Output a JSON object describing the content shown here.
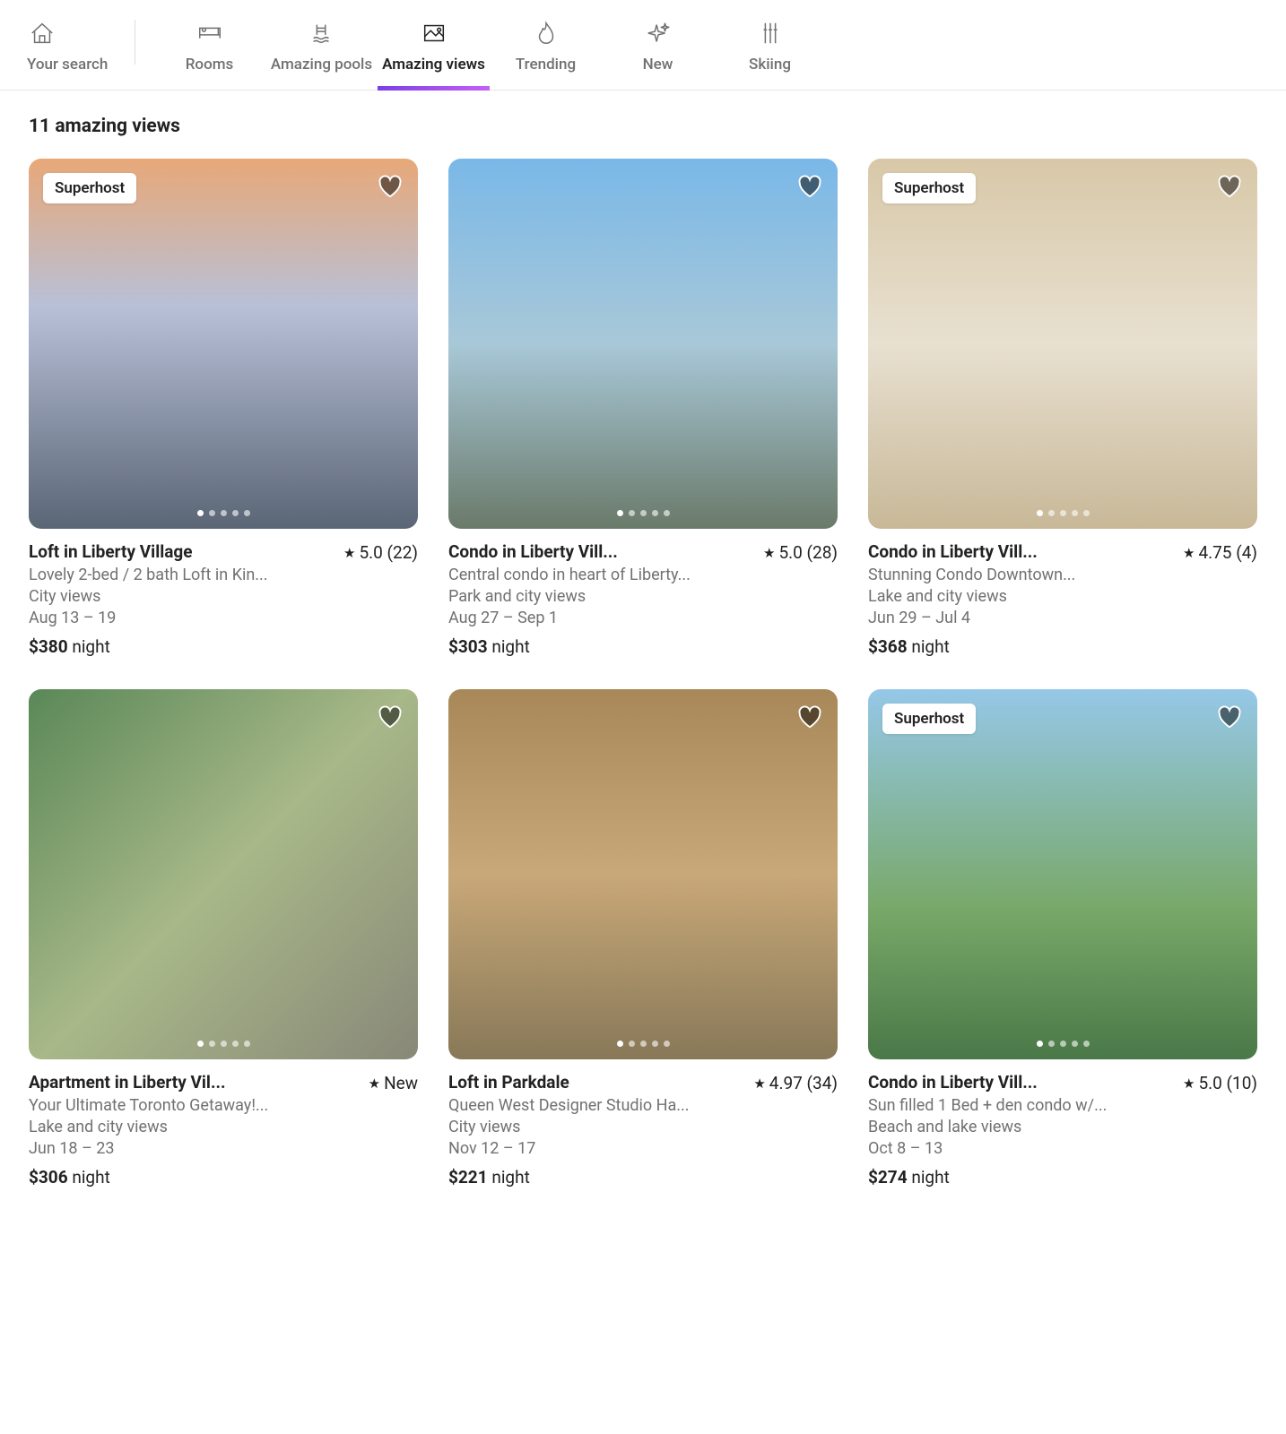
{
  "tabs": [
    {
      "label": "Your search",
      "icon": "house-icon",
      "active": false
    },
    {
      "label": "Rooms",
      "icon": "bed-icon",
      "active": false
    },
    {
      "label": "Amazing pools",
      "icon": "pool-icon",
      "active": false
    },
    {
      "label": "Amazing views",
      "icon": "picture-icon",
      "active": true
    },
    {
      "label": "Trending",
      "icon": "flame-icon",
      "active": false
    },
    {
      "label": "New",
      "icon": "sparkle-icon",
      "active": false
    },
    {
      "label": "Skiing",
      "icon": "ski-icon",
      "active": false
    }
  ],
  "heading": "11 amazing views",
  "badges": {
    "superhost": "Superhost"
  },
  "listings": [
    {
      "title": "Loft in Liberty Village",
      "rating_label": "5.0 (22)",
      "desc": "Lovely 2-bed / 2 bath Loft in Kin...",
      "views": "City views",
      "dates": "Aug 13 – 19",
      "price": "$380",
      "price_unit": " night",
      "superhost": true,
      "dots": 5,
      "current_dot": 0
    },
    {
      "title": "Condo in Liberty Vill...",
      "rating_label": "5.0 (28)",
      "desc": "Central condo in heart of Liberty...",
      "views": "Park and city views",
      "dates": "Aug 27 – Sep 1",
      "price": "$303",
      "price_unit": " night",
      "superhost": false,
      "dots": 5,
      "current_dot": 0
    },
    {
      "title": "Condo in Liberty Vill...",
      "rating_label": "4.75 (4)",
      "desc": "Stunning Condo Downtown...",
      "views": "Lake and city views",
      "dates": "Jun 29 – Jul 4",
      "price": "$368",
      "price_unit": " night",
      "superhost": true,
      "dots": 5,
      "current_dot": 0
    },
    {
      "title": "Apartment in Liberty Vil...",
      "rating_label": "New",
      "desc": "Your Ultimate Toronto Getaway!...",
      "views": "Lake and city views",
      "dates": "Jun 18 – 23",
      "price": "$306",
      "price_unit": " night",
      "superhost": false,
      "dots": 5,
      "current_dot": 0
    },
    {
      "title": "Loft in Parkdale",
      "rating_label": "4.97 (34)",
      "desc": "Queen West Designer Studio Ha...",
      "views": "City views",
      "dates": "Nov 12 – 17",
      "price": "$221",
      "price_unit": " night",
      "superhost": false,
      "dots": 5,
      "current_dot": 0
    },
    {
      "title": "Condo in Liberty Vill...",
      "rating_label": "5.0 (10)",
      "desc": "Sun filled 1 Bed + den condo w/...",
      "views": "Beach and lake views",
      "dates": "Oct 8 – 13",
      "price": "$274",
      "price_unit": " night",
      "superhost": true,
      "dots": 5,
      "current_dot": 0
    }
  ]
}
